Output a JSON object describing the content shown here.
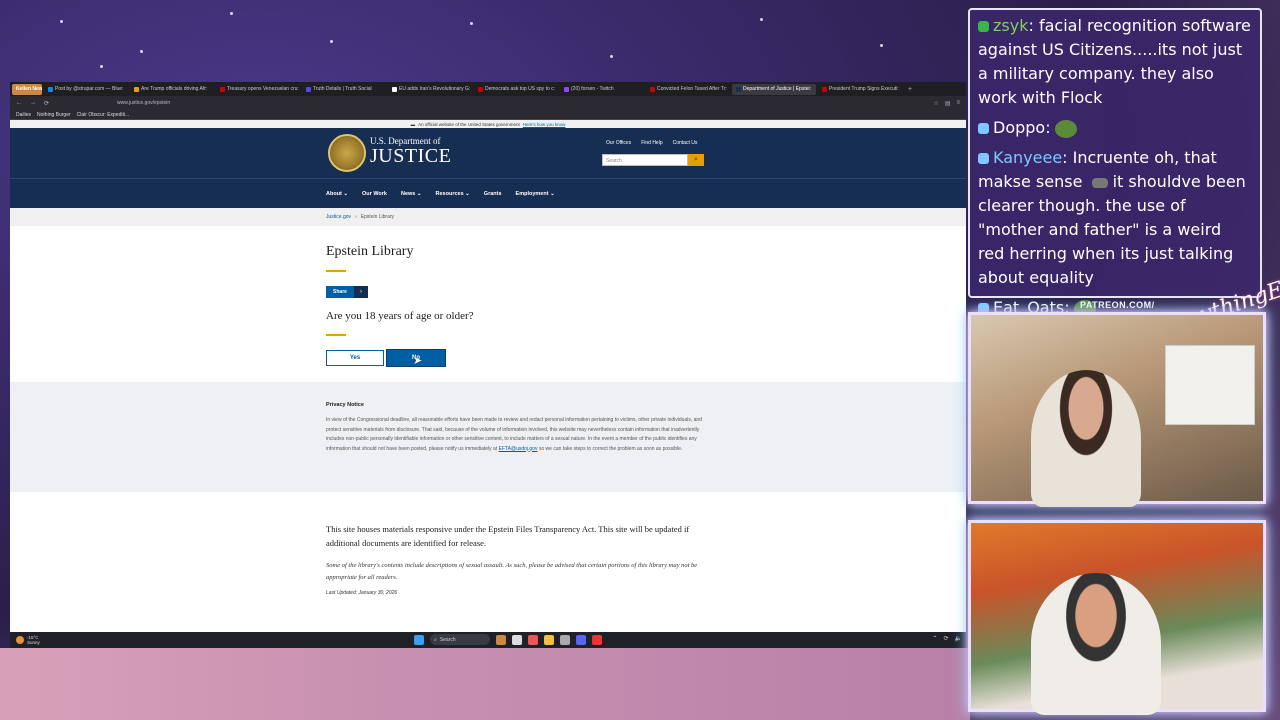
{
  "tabs": [
    {
      "label": "Kellen News",
      "color": "#c84"
    },
    {
      "label": "Post by @strupar.com — Blue:",
      "color": "#1185fe"
    },
    {
      "label": "Are Trump officials driving Afr:",
      "color": "#e8a000"
    },
    {
      "label": "Treasury opens Venezuelan cru:",
      "color": "#c00"
    },
    {
      "label": "Truth Details | Truth Social",
      "color": "#5448ee"
    },
    {
      "label": "EU adds Iran's Revolutionary G:",
      "color": "#fff"
    },
    {
      "label": "Democrats ask top US spy to c:",
      "color": "#c00"
    },
    {
      "label": "(20) forsen - Twitch",
      "color": "#9146ff"
    },
    {
      "label": "Convicted Felon Taxed After Tr:",
      "color": "#c00"
    },
    {
      "label": "Department of Justice | Epstei:",
      "color": "#162e51"
    },
    {
      "label": "President Trump Signs Executi:",
      "color": "#c00"
    }
  ],
  "url": "www.justice.gov/epstein",
  "bookmarks": [
    "Dailies",
    "Nothing Burger",
    "Clair Obscur: Expediti..."
  ],
  "gov_banner": {
    "text": "An official website of the United States government",
    "link": "Here's how you know"
  },
  "doj": {
    "name_small": "U.S. Department of",
    "name_big": "JUSTICE",
    "toplinks": [
      "Our Offices",
      "Find Help",
      "Contact Us"
    ],
    "search_placeholder": "Search",
    "nav": [
      "About",
      "Our Work",
      "News",
      "Resources",
      "Grants",
      "Employment"
    ]
  },
  "breadcrumb": {
    "home": "Justice.gov",
    "current": "Epstein Library"
  },
  "page": {
    "title": "Epstein Library",
    "share": "Share",
    "age_question": "Are you 18 years of age or older?",
    "yes": "Yes",
    "no": "No"
  },
  "privacy": {
    "heading": "Privacy Notice",
    "body": "In view of the Congressional deadline, all reasonable efforts have been made to review and redact personal information pertaining to victims, other private individuals, and protect sensitive materials from disclosure.  That said, because of the volume of information involved, this website may nevertheless contain information that inadvertently includes non-public personally identifiable information or other sensitive content, to include matters of a sexual nature.  In the event a member of the public identifies any information that should not have been posted, please notify us immediately at",
    "email": "EFTA@usdoj.gov",
    "tail": "so we can take steps to correct the problem as soon as possible."
  },
  "library": {
    "main": "This site houses materials responsive under the Epstein Files Transparency Act. This site will be updated if additional documents are identified for release.",
    "warning": "Some of the library's contents include descriptions of sexual assault. As such, please be advised that certain portions of this library may not be appropriate for all readers.",
    "updated": "Last Updated: January 30, 2026"
  },
  "taskbar": {
    "temp": "-15°C",
    "cond": "Sunny",
    "search": "Search"
  },
  "chat": [
    {
      "user": "zsyk",
      "badge": "k",
      "text": "facial recognition software against US Citizens.....its not just a military company. they also work with Flock"
    },
    {
      "user": "Doppo",
      "badge": "t",
      "text": ""
    },
    {
      "user": "Kanyeee",
      "badge": "t",
      "text": "Incruente oh, that makse sense",
      "text2": "it shouldve been clearer though. the use of \"mother and father\" is a weird red herring when its just talking about equality"
    },
    {
      "user": "Eat_Oats",
      "badge": "t",
      "text": ""
    }
  ],
  "overlay": {
    "patreon": "PATREON.COM/",
    "script": "AnythingElse"
  }
}
